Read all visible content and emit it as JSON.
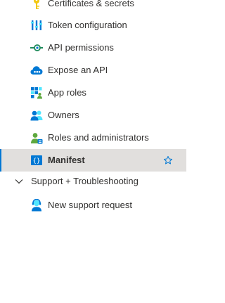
{
  "nav": {
    "items": [
      {
        "label": "Certificates & secrets",
        "icon": "key-icon"
      },
      {
        "label": "Token configuration",
        "icon": "token-bars-icon"
      },
      {
        "label": "API permissions",
        "icon": "api-permissions-icon"
      },
      {
        "label": "Expose an API",
        "icon": "cloud-api-icon"
      },
      {
        "label": "App roles",
        "icon": "app-roles-grid-icon"
      },
      {
        "label": "Owners",
        "icon": "owners-people-icon"
      },
      {
        "label": "Roles and administrators",
        "icon": "roles-admin-icon"
      },
      {
        "label": "Manifest",
        "icon": "manifest-braces-icon",
        "selected": true
      }
    ],
    "group": {
      "label": "Support + Troubleshooting",
      "expanded": true,
      "items": [
        {
          "label": "New support request",
          "icon": "support-person-icon"
        }
      ]
    }
  },
  "colors": {
    "selected_bg": "#e1dfdd",
    "accent": "#0078d4",
    "text": "#323130"
  }
}
